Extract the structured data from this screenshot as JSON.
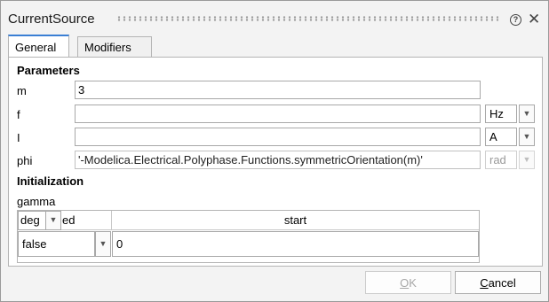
{
  "window": {
    "title": "CurrentSource"
  },
  "tabs": [
    {
      "label": "General"
    },
    {
      "label": "Modifiers"
    }
  ],
  "parameters": {
    "section_title": "Parameters",
    "m": {
      "label": "m",
      "value": "3"
    },
    "f": {
      "label": "f",
      "value": "",
      "unit": "Hz"
    },
    "I": {
      "label": "I",
      "value": "",
      "unit": "A"
    },
    "phi": {
      "label": "phi",
      "value": "'-Modelica.Electrical.Polyphase.Functions.symmetricOrientation(m)'",
      "unit": "rad"
    }
  },
  "initialization": {
    "section_title": "Initialization",
    "gamma_label": "gamma",
    "unit_select": "deg",
    "fixed_header_partial": "ed",
    "start_header": "start",
    "fixed_value": "false",
    "start_value": "0"
  },
  "buttons": {
    "ok": {
      "label": "OK",
      "mnemonic": "O",
      "rest": "K"
    },
    "cancel": {
      "label": "Cancel",
      "mnemonic": "C",
      "rest": "ancel"
    }
  },
  "icons": {
    "help": "help-icon",
    "close": "close-icon",
    "dropdown": "chevron-down-icon"
  },
  "colors": {
    "accent": "#3a7fd4",
    "window_bg": "#f3f3f3"
  }
}
